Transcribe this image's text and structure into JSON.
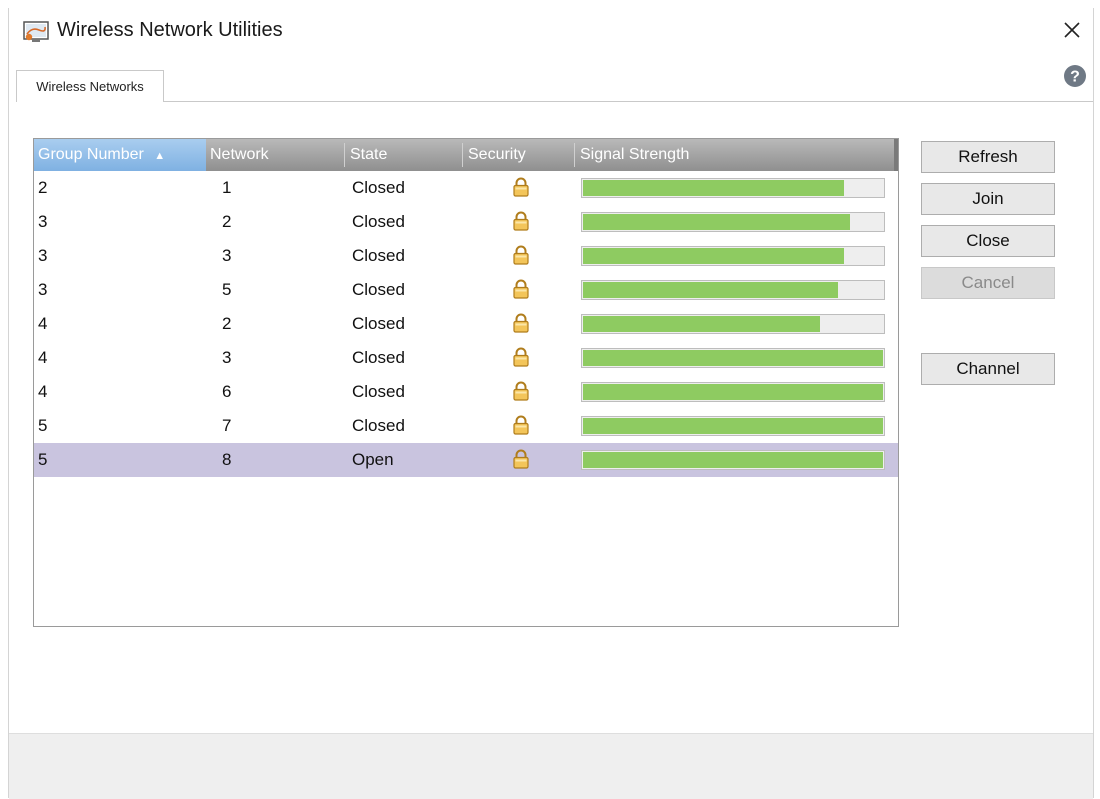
{
  "window": {
    "title": "Wireless Network Utilities"
  },
  "tabs": [
    {
      "label": "Wireless Networks",
      "active": true
    }
  ],
  "table": {
    "columns": [
      "Group Number",
      "Network",
      "State",
      "Security",
      "Signal Strength"
    ],
    "sorted_column": "Group Number",
    "sort_direction": "ascending",
    "rows": [
      {
        "group": "2",
        "network": "1",
        "state": "Closed",
        "security": "lock-icon",
        "signal": 0.87
      },
      {
        "group": "3",
        "network": "2",
        "state": "Closed",
        "security": "lock-icon",
        "signal": 0.89
      },
      {
        "group": "3",
        "network": "3",
        "state": "Closed",
        "security": "lock-icon",
        "signal": 0.87
      },
      {
        "group": "3",
        "network": "5",
        "state": "Closed",
        "security": "lock-icon",
        "signal": 0.85
      },
      {
        "group": "4",
        "network": "2",
        "state": "Closed",
        "security": "lock-icon",
        "signal": 0.79
      },
      {
        "group": "4",
        "network": "3",
        "state": "Closed",
        "security": "lock-icon",
        "signal": 1.0
      },
      {
        "group": "4",
        "network": "6",
        "state": "Closed",
        "security": "lock-icon",
        "signal": 1.0
      },
      {
        "group": "5",
        "network": "7",
        "state": "Closed",
        "security": "lock-icon",
        "signal": 1.0
      },
      {
        "group": "5",
        "network": "8",
        "state": "Open",
        "security": "lock-icon",
        "signal": 1.0,
        "selected": true
      }
    ]
  },
  "buttons": {
    "refresh": "Refresh",
    "join": "Join",
    "close": "Close",
    "cancel": "Cancel",
    "cancel_disabled": true,
    "channel": "Channel"
  },
  "colors": {
    "signal_fill": "#8ecb61",
    "selected_row": "#c9c4df",
    "header_bg": "#a0a0a0",
    "sorted_header_bg": "#94bfe9"
  }
}
